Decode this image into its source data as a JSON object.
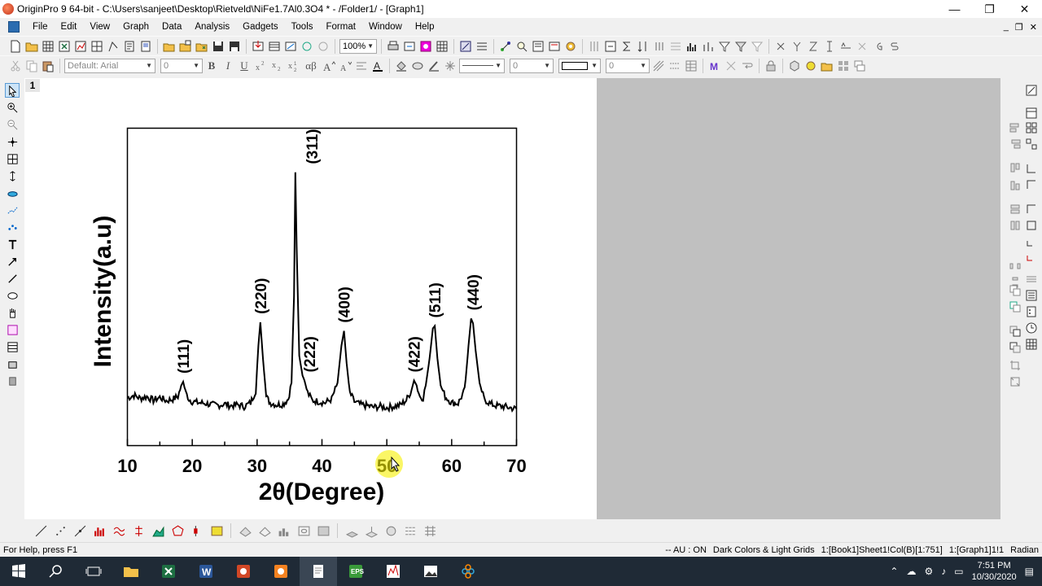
{
  "window": {
    "title": "OriginPro 9 64-bit - C:\\Users\\sanjeet\\Desktop\\Rietveld\\NiFe1.7Al0.3O4 * - /Folder1/ - [Graph1]",
    "minimize": "—",
    "restore": "❐",
    "close": "✕"
  },
  "menu": {
    "items": [
      "File",
      "Edit",
      "View",
      "Graph",
      "Data",
      "Analysis",
      "Gadgets",
      "Tools",
      "Format",
      "Window",
      "Help"
    ],
    "mdi_minimize": "_",
    "mdi_restore": "❐",
    "mdi_close": "✕"
  },
  "toolbar": {
    "zoom_value": "100%",
    "font_value": "Default: Arial",
    "font_size": "0",
    "bold": "B",
    "italic": "I",
    "underline": "U",
    "greek": "αβ",
    "line_width": "0",
    "border_width": "0"
  },
  "graph": {
    "layer_tab": "1"
  },
  "chart_data": {
    "type": "line",
    "xlabel": "2θ(Degree)",
    "ylabel": "Intensity(a.u)",
    "xlim": [
      10,
      70
    ],
    "xticks": [
      10,
      20,
      30,
      40,
      50,
      60,
      70
    ],
    "grid": false,
    "legend": "none",
    "line_color": "#000000",
    "series": [
      {
        "x": [
          10,
          11,
          12,
          13,
          14,
          15,
          16,
          17,
          17.8,
          18.3,
          18.6,
          19,
          19.5,
          20,
          21,
          22,
          23,
          24,
          25,
          26,
          27,
          28,
          29,
          29.8,
          30.2,
          30.5,
          30.9,
          31.4,
          32,
          33,
          34,
          34.8,
          35.3,
          35.7,
          35.9,
          36.1,
          36.5,
          37,
          37.3,
          37.8,
          38.5,
          39.5,
          40.5,
          41.5,
          42.4,
          43,
          43.4,
          43.8,
          44.3,
          45,
          46,
          47,
          48,
          49,
          50,
          51,
          52,
          53,
          53.8,
          54.2,
          54.6,
          55.1,
          55.6,
          56,
          56.6,
          57.1,
          57.4,
          57.8,
          58.3,
          59,
          60,
          61,
          62,
          62.6,
          63,
          63.3,
          63.7,
          64.3,
          65,
          66,
          67,
          68,
          69,
          70
        ],
        "y": [
          90,
          100,
          88,
          95,
          80,
          92,
          78,
          85,
          95,
          140,
          155,
          110,
          85,
          75,
          70,
          68,
          62,
          60,
          65,
          58,
          62,
          55,
          70,
          120,
          300,
          395,
          250,
          95,
          70,
          62,
          65,
          85,
          150,
          500,
          1000,
          700,
          260,
          180,
          160,
          110,
          80,
          75,
          70,
          85,
          150,
          300,
          360,
          230,
          110,
          75,
          62,
          58,
          52,
          55,
          50,
          55,
          60,
          80,
          120,
          160,
          140,
          95,
          90,
          140,
          250,
          370,
          380,
          250,
          140,
          95,
          70,
          68,
          120,
          300,
          410,
          390,
          280,
          150,
          85,
          65,
          58,
          55,
          50,
          45
        ]
      }
    ],
    "annotations": [
      {
        "label": "(111)",
        "x": 18.6,
        "y": 155
      },
      {
        "label": "(220)",
        "x": 30.5,
        "y": 395
      },
      {
        "label": "(311)",
        "x": 35.9,
        "y": 1000
      },
      {
        "label": "(222)",
        "x": 37.3,
        "y": 160
      },
      {
        "label": "(400)",
        "x": 43.4,
        "y": 360
      },
      {
        "label": "(422)",
        "x": 54.2,
        "y": 160
      },
      {
        "label": "(511)",
        "x": 57.4,
        "y": 380
      },
      {
        "label": "(440)",
        "x": 63.3,
        "y": 410
      }
    ]
  },
  "status": {
    "help": "For Help, press F1",
    "au": "-- AU : ON",
    "theme": "Dark Colors & Light Grids",
    "sheet": "1:[Book1]Sheet1!Col(B)[1:751]",
    "graph": "1:[Graph1]1!1",
    "unit": "Radian"
  },
  "taskbar": {
    "time": "7:51 PM",
    "date": "10/30/2020",
    "colors": {
      "bg": "#1f2a36"
    }
  }
}
